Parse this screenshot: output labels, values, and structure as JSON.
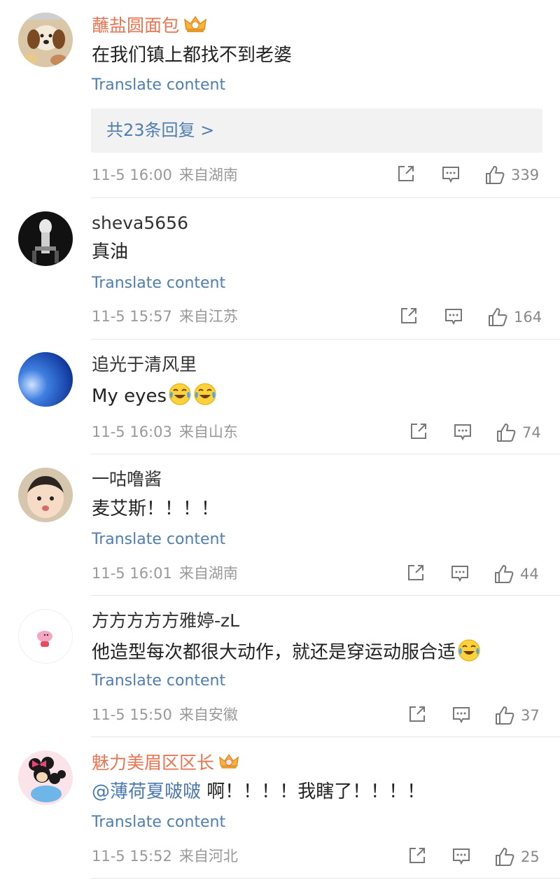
{
  "comments": [
    {
      "username": "蘸盐圆面包",
      "text": "在我们镇上都找不到老婆",
      "translate": "Translate content",
      "replies": "共23条回复 >",
      "time": "11-5 16:00",
      "location": "来自湖南",
      "likes": "339",
      "avatar_icon": "puppy-avatar"
    },
    {
      "username": "sheva5656",
      "text": "真油",
      "translate": "Translate content",
      "time": "11-5 15:57",
      "location": "来自江苏",
      "likes": "164",
      "avatar_icon": "dark-figure-avatar"
    },
    {
      "username": "追光于清风里",
      "text": "My eyes",
      "time": "11-5 16:03",
      "location": "来自山东",
      "likes": "74",
      "avatar_icon": "blue-sky-avatar"
    },
    {
      "username": "一咕噜酱",
      "text": "麦艾斯！！！！",
      "translate": "Translate content",
      "time": "11-5 16:01",
      "location": "来自湖南",
      "likes": "44",
      "avatar_icon": "baby-avatar"
    },
    {
      "username": "方方方方方雅婷-zL",
      "text": "他造型每次都很大动作，就还是穿运动服合适",
      "translate": "Translate content",
      "time": "11-5 15:50",
      "location": "来自安徽",
      "likes": "37",
      "avatar_icon": "peppa-pig-avatar"
    },
    {
      "username": "魅力美眉区区长",
      "mention": "@薄荷夏啵啵",
      "text": " 啊！！！！我瞎了！！！！",
      "translate": "Translate content",
      "time": "11-5 15:52",
      "location": "来自河北",
      "likes": "25",
      "avatar_icon": "mickey-minnie-avatar"
    }
  ],
  "colors": {
    "vip_name": "#eb7350",
    "link": "#507daf",
    "meta": "#999999"
  }
}
